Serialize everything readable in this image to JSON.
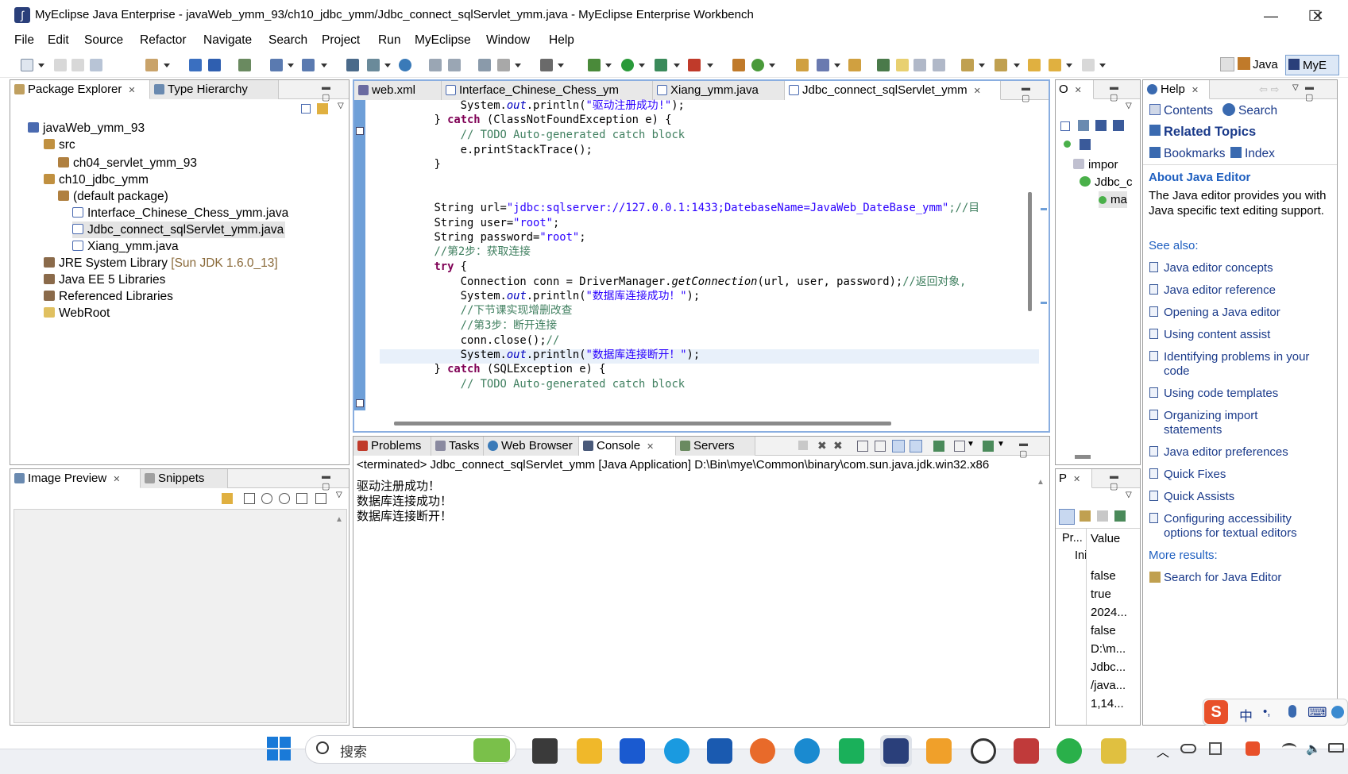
{
  "window": {
    "title": "MyEclipse Java Enterprise - javaWeb_ymm_93/ch10_jdbc_ymm/Jdbc_connect_sqlServlet_ymm.java - MyEclipse Enterprise Workbench",
    "minimize": "—",
    "maximize": "☐",
    "close": "✕"
  },
  "menu": [
    "File",
    "Edit",
    "Source",
    "Refactor",
    "Navigate",
    "Search",
    "Project",
    "Run",
    "MyEclipse",
    "Window",
    "Help"
  ],
  "perspectives": {
    "java": "Java",
    "myeclipse": "MyE"
  },
  "package_explorer": {
    "tabs": [
      "Package Explorer",
      "Type Hierarchy"
    ],
    "tree": [
      {
        "label": "javaWeb_ymm_93",
        "suffix": ""
      },
      {
        "label": "src",
        "suffix": ""
      },
      {
        "label": "ch04_servlet_ymm_93",
        "suffix": ""
      },
      {
        "label": "ch10_jdbc_ymm",
        "suffix": ""
      },
      {
        "label": "(default package)",
        "suffix": ""
      },
      {
        "label": "Interface_Chinese_Chess_ymm.java",
        "suffix": ""
      },
      {
        "label": "Jdbc_connect_sqlServlet_ymm.java",
        "suffix": ""
      },
      {
        "label": "Xiang_ymm.java",
        "suffix": ""
      },
      {
        "label": "JRE System Library",
        "suffix": "[Sun JDK 1.6.0_13]"
      },
      {
        "label": "Java EE 5 Libraries",
        "suffix": ""
      },
      {
        "label": "Referenced Libraries",
        "suffix": ""
      },
      {
        "label": "WebRoot",
        "suffix": ""
      }
    ]
  },
  "image_preview": {
    "tabs": [
      "Image Preview",
      "Snippets"
    ]
  },
  "editor": {
    "tabs": [
      "web.xml",
      "Interface_Chinese_Chess_ym",
      "Xiang_ymm.java",
      "Jdbc_connect_sqlServlet_ymm"
    ],
    "code": {
      "l0a": "            System.",
      "l0b": "out",
      "l0c": ".println(",
      "l0d": "\"驱动注册成功!\"",
      "l0e": ");",
      "l1a": "        } ",
      "l1kw": "catch",
      "l1b": " (ClassNotFoundException e) {",
      "l2": "            // TODO Auto-generated catch block",
      "l3": "            e.printStackTrace();",
      "l4": "        }",
      "l7a": "        String url=",
      "l7b": "\"jdbc:sqlserver://127.0.0.1:1433;DatebaseName=JavaWeb_DateBase_ymm\"",
      "l7c": ";//目",
      "l8a": "        String user=",
      "l8b": "\"root\"",
      "l8c": ";",
      "l9a": "        String password=",
      "l9b": "\"root\"",
      "l9c": ";",
      "l10": "        //第2步：获取连接",
      "l11kw": "try",
      "l11b": " {",
      "l12a": "            Connection conn = DriverManager.",
      "l12b": "getConnection",
      "l12c": "(url, user, password);",
      "l12d": "//返回对象,",
      "l13a": "            System.",
      "l13b": "out",
      "l13c": ".println(",
      "l13d": "\"数据库连接成功！\"",
      "l13e": ");",
      "l14": "            //下节课实现增删改查",
      "l15": "            //第3步：断开连接",
      "l16a": "            conn.close();",
      "l16b": "//",
      "l17a": "            System.",
      "l17b": "out",
      "l17c": ".println(",
      "l17d": "\"数据库连接断开！\"",
      "l17e": ");",
      "l18a": "        } ",
      "l18kw": "catch",
      "l18b": " (SQLException e) {",
      "l19": "            // TODO Auto-generated catch block"
    }
  },
  "outline": {
    "tab": "O",
    "items": [
      "impor",
      "Jdbc_c",
      "ma"
    ]
  },
  "console": {
    "tabs": [
      "Problems",
      "Tasks",
      "Web Browser",
      "Console",
      "Servers"
    ],
    "header": "<terminated> Jdbc_connect_sqlServlet_ymm [Java Application] D:\\Bin\\mye\\Common\\binary\\com.sun.java.jdk.win32.x86",
    "lines": [
      "驱动注册成功！",
      "数据库连接成功！",
      "数据库连接断开！"
    ]
  },
  "properties": {
    "tab": "P",
    "col_property": "Pr...",
    "col_property2": "Ini",
    "col_value": "Value",
    "values": [
      "false",
      "true",
      "2024...",
      "false",
      "D:\\m...",
      "Jdbc...",
      "/java...",
      "1,14..."
    ]
  },
  "help": {
    "tab": "Help",
    "contents": "Contents",
    "search": "Search",
    "related": "Related Topics",
    "bookmarks": "Bookmarks",
    "index": "Index",
    "about_title": "About Java Editor",
    "about_text": "The Java editor provides you with Java specific text editing support.",
    "see_also": "See also:",
    "links": [
      "Java editor concepts",
      "Java editor reference",
      "Opening a Java editor",
      "Using content assist",
      "Identifying problems in your code",
      "Using code templates",
      "Organizing import statements",
      "Java editor preferences",
      "Quick Fixes",
      "Quick Assists",
      "Configuring accessibility options for textual editors"
    ],
    "more_results": "More results:",
    "search_for": "Search for Java Editor"
  },
  "taskbar": {
    "search_placeholder": "搜索",
    "tray": {
      "lang": "中",
      "punct": "•,",
      "keyboard": "⌨"
    }
  },
  "colors": {
    "keyword": "#7f0055",
    "string": "#2a00ff",
    "comment": "#3f7f5f",
    "accent": "#0066cc"
  }
}
